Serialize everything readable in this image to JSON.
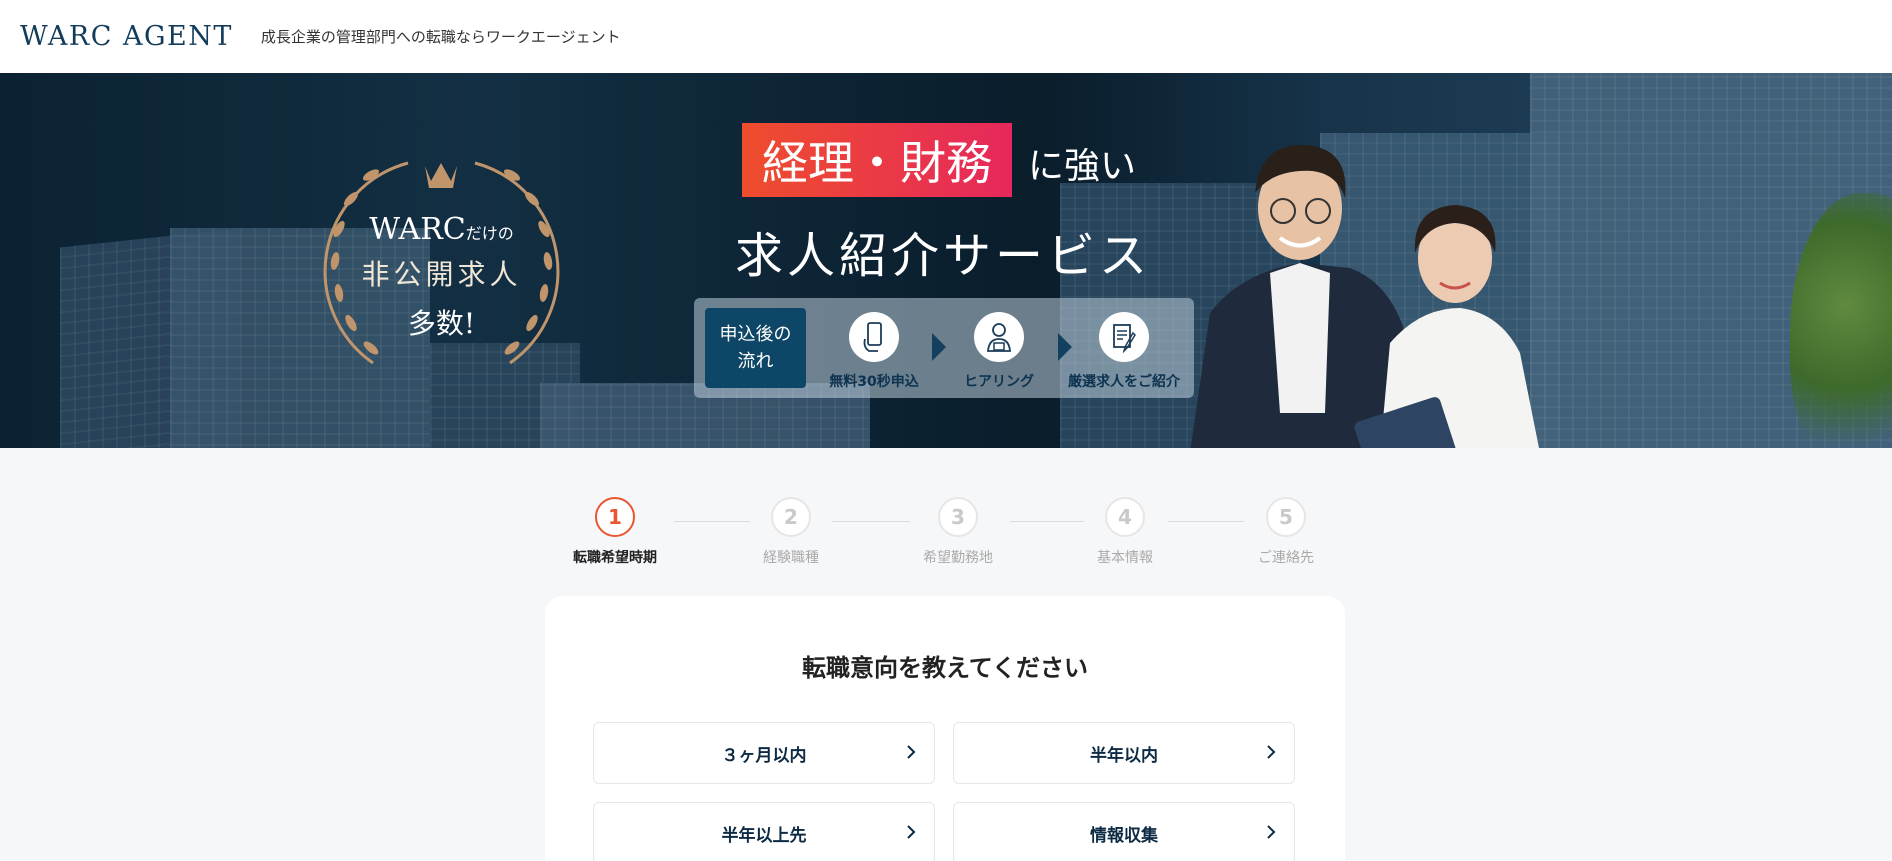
{
  "header": {
    "logo": "WARC AGENT",
    "tagline": "成長企業の管理部門への転職ならワークエージェント"
  },
  "hero": {
    "badge": {
      "line1_main": "WARC",
      "line1_small": "だけの",
      "line2": "非公開求人",
      "line3": "多数!"
    },
    "headline_box": "経理・財務",
    "headline_suffix": "に強い",
    "headline_sub": "求人紹介サービス",
    "flow": {
      "title_line1": "申込後の",
      "title_line2": "流れ",
      "steps": [
        {
          "label": "無料30秒申込",
          "icon": "smartphone-hand-icon"
        },
        {
          "label": "ヒアリング",
          "icon": "person-hearing-icon"
        },
        {
          "label": "厳選求人をご紹介",
          "icon": "document-pen-icon"
        }
      ]
    },
    "colors": {
      "accent_start": "#ee4d2d",
      "accent_end": "#e6285c",
      "navy": "#0d4666"
    }
  },
  "stepper": {
    "steps": [
      {
        "num": "1",
        "label": "転職希望時期",
        "active": true
      },
      {
        "num": "2",
        "label": "経験職種",
        "active": false
      },
      {
        "num": "3",
        "label": "希望勤務地",
        "active": false
      },
      {
        "num": "4",
        "label": "基本情報",
        "active": false
      },
      {
        "num": "5",
        "label": "ご連絡先",
        "active": false
      }
    ],
    "active_color": "#e8572f"
  },
  "form": {
    "title": "転職意向を教えてください",
    "options": [
      {
        "label": "３ヶ月以内"
      },
      {
        "label": "半年以内"
      },
      {
        "label": "半年以上先"
      },
      {
        "label": "情報収集"
      }
    ]
  }
}
